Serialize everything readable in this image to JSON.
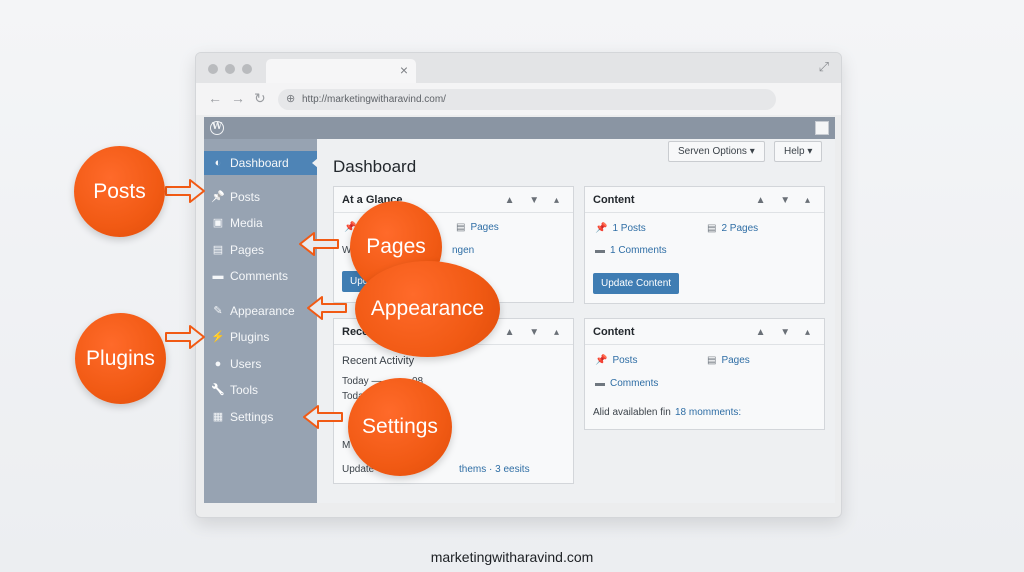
{
  "browser": {
    "tab_close": "×",
    "expand_icon": "⤢",
    "nav_back": "←",
    "nav_forward": "→",
    "nav_reload": "↻",
    "url": "http://marketingwitharavind.com/"
  },
  "admin": {
    "title": "Dashboard",
    "screen_options": "Serven Options ▾",
    "help": "Help ▾"
  },
  "sidebar": {
    "items": [
      {
        "label": "Dashboard",
        "icon": "dashboard-icon",
        "glyph": "◐",
        "active": true
      },
      {
        "label": "Posts",
        "icon": "pin-icon",
        "glyph": "📌"
      },
      {
        "label": "Media",
        "icon": "media-icon",
        "glyph": "▣"
      },
      {
        "label": "Pages",
        "icon": "pages-icon",
        "glyph": "▤"
      },
      {
        "label": "Comments",
        "icon": "comment-icon",
        "glyph": "▬"
      },
      {
        "label": "Appearance",
        "icon": "brush-icon",
        "glyph": "✎"
      },
      {
        "label": "Plugins",
        "icon": "plug-icon",
        "glyph": "⚡"
      },
      {
        "label": "Users",
        "icon": "user-icon",
        "glyph": "●"
      },
      {
        "label": "Tools",
        "icon": "wrench-icon",
        "glyph": "🔧"
      },
      {
        "label": "Settings",
        "icon": "settings-icon",
        "glyph": "▦"
      }
    ]
  },
  "widgets": {
    "glance": {
      "title": "At a Glance",
      "pages": "Pages",
      "line2": "W",
      "line2b": "ngen",
      "button": "Upd"
    },
    "content1": {
      "title": "Content",
      "posts": "1 Posts",
      "pages": "2 Pages",
      "comments": "1 Comments",
      "button": "Update Content"
    },
    "recent": {
      "title": "Rece",
      "heading": "Recent Activity",
      "line1": "Today —",
      "line1b": "08",
      "line2": "Toda",
      "line3": "M",
      "footer_pre": "Update",
      "footer_link": "thems · 3 eesits"
    },
    "content2": {
      "title": "Content",
      "posts": "Posts",
      "pages": "Pages",
      "comments": "Comments",
      "note_pre": "Alid availablen fin",
      "note_link": "18 momments:"
    },
    "controls": "▲ ▼ ▴"
  },
  "callouts": {
    "posts": "Posts",
    "pages": "Pages",
    "appearance": "Appearance",
    "plugins": "Plugins",
    "settings": "Settings"
  },
  "colors": {
    "accent": "#f15a14",
    "sidebar": "#97a3b2",
    "active": "#4e84b6",
    "button": "#3f7db3"
  },
  "footer": "marketingwitharavind.com"
}
